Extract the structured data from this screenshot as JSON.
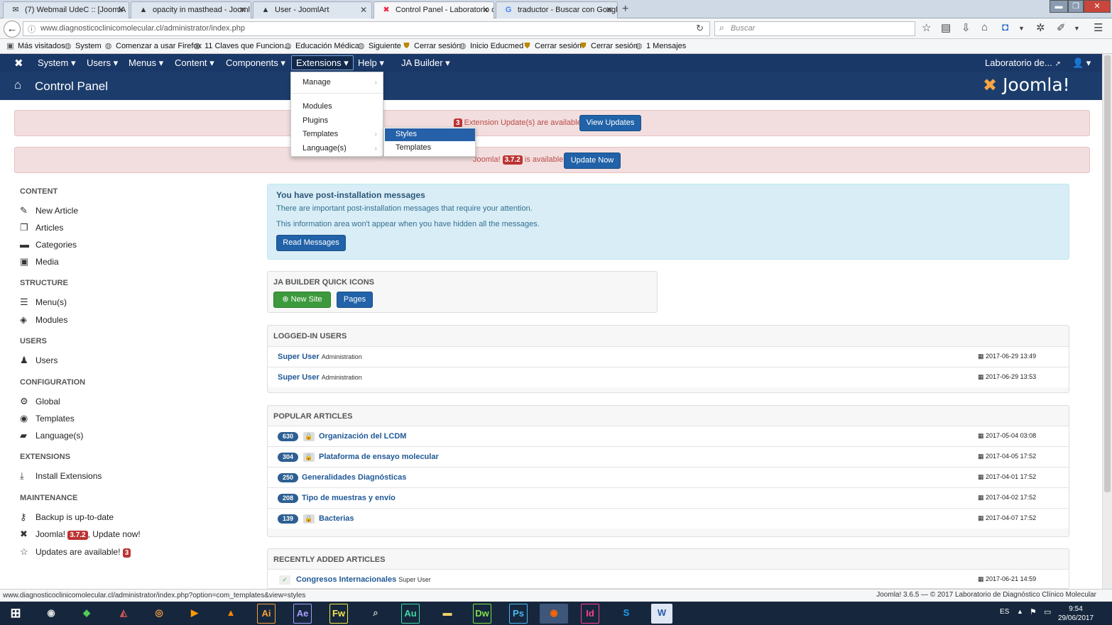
{
  "browser": {
    "tabs": [
      {
        "label": "(7) Webmail UdeC :: [JoomlA",
        "icon": "mail-icon"
      },
      {
        "label": "opacity in masthead - Jooml",
        "icon": "joomlart-icon"
      },
      {
        "label": "User - JoomlArt",
        "icon": "joomlart-icon"
      },
      {
        "label": "Control Panel - Laboratorio d",
        "icon": "joomla-icon"
      },
      {
        "label": "traductor - Buscar con Googl",
        "icon": "google-icon"
      }
    ],
    "url": "www.diagnosticoclinicomolecular.cl/administrator/index.php",
    "search_placeholder": "Buscar",
    "bookmarks": [
      "Más visitados",
      "System",
      "Comenzar a usar Firefox",
      "11 Claves que Funcion...",
      "Educación Médica",
      "Siguiente",
      "Cerrar sesión",
      "Inicio Educmed",
      "Cerrar sesión",
      "Cerrar sesión",
      "1 Mensajes"
    ],
    "status_url": "www.diagnosticoclinicomolecular.cl/administrator/index.php?option=com_templates&view=styles"
  },
  "admin": {
    "menu": [
      "System",
      "Users",
      "Menus",
      "Content",
      "Components",
      "Extensions",
      "Help",
      "JA Builder"
    ],
    "site_name": "Laboratorio de...",
    "page_title": "Control Panel",
    "logo_text": "Joomla!"
  },
  "dropdown": {
    "items": [
      "Manage",
      "Modules",
      "Plugins",
      "Templates",
      "Language(s)"
    ],
    "submenu": [
      "Styles",
      "Templates"
    ]
  },
  "alerts": {
    "ext_text": "Extension Update(s) are available:",
    "ext_count": "3",
    "ext_button": "View Updates",
    "joomla_prefix": "Joomla!",
    "joomla_version": "3.7.2",
    "joomla_suffix": "is available:",
    "joomla_button": "Update Now"
  },
  "sidebar": {
    "content_head": "CONTENT",
    "content": [
      "New Article",
      "Articles",
      "Categories",
      "Media"
    ],
    "structure_head": "STRUCTURE",
    "structure": [
      "Menu(s)",
      "Modules"
    ],
    "users_head": "USERS",
    "users": [
      "Users"
    ],
    "config_head": "CONFIGURATION",
    "config": [
      "Global",
      "Templates",
      "Language(s)"
    ],
    "ext_head": "EXTENSIONS",
    "ext": [
      "Install Extensions"
    ],
    "maint_head": "MAINTENANCE",
    "backup": "Backup is up-to-date",
    "joomla_label": "Joomla!",
    "joomla_version": "3.7.2",
    "joomla_update": ", Update now!",
    "updates_label": "Updates are available!",
    "updates_count": "3"
  },
  "info": {
    "title": "You have post-installation messages",
    "line1": "There are important post-installation messages that require your attention.",
    "line2": "This information area won't appear when you have hidden all the messages.",
    "button": "Read Messages"
  },
  "quickicons": {
    "title": "JA BUILDER QUICK ICONS",
    "new_site": "New Site",
    "pages": "Pages"
  },
  "logged": {
    "title": "LOGGED-IN USERS",
    "rows": [
      {
        "user": "Super User",
        "area": "Administration",
        "date": "2017-06-29 13:49"
      },
      {
        "user": "Super User",
        "area": "Administration",
        "date": "2017-06-29 13:53"
      }
    ]
  },
  "popular": {
    "title": "POPULAR ARTICLES",
    "rows": [
      {
        "hits": "630",
        "title": "Organización del LCDM",
        "date": "2017-05-04 03:08",
        "locked": true
      },
      {
        "hits": "304",
        "title": "Plataforma de ensayo molecular",
        "date": "2017-04-05 17:52",
        "locked": true
      },
      {
        "hits": "250",
        "title": "Generalidades Diagnósticas",
        "date": "2017-04-01 17:52",
        "locked": false
      },
      {
        "hits": "208",
        "title": "Tipo de muestras y envío",
        "date": "2017-04-02 17:52",
        "locked": false
      },
      {
        "hits": "139",
        "title": "Bacterias",
        "date": "2017-04-07 17:52",
        "locked": true
      }
    ]
  },
  "recent": {
    "title": "RECENTLY ADDED ARTICLES",
    "row": {
      "title": "Congresos Internacionales",
      "author": "Super User",
      "date": "2017-06-21 14:59"
    }
  },
  "footer": "Joomla! 3.6.5  —  © 2017 Laboratorio de Diagnóstico Clínico Molecular",
  "taskbar": {
    "apps": [
      "Ai",
      "Ae",
      "Fw",
      "Au",
      "Dw",
      "Ps",
      "Id"
    ],
    "lang": "ES",
    "time": "9:54",
    "date": "29/06/2017"
  },
  "colors": {
    "admin_nav": "#1a3867",
    "header": "#1c3d6c",
    "link": "#1f5896",
    "alert_bg": "#f2dede",
    "info_bg": "#d9edf7"
  }
}
